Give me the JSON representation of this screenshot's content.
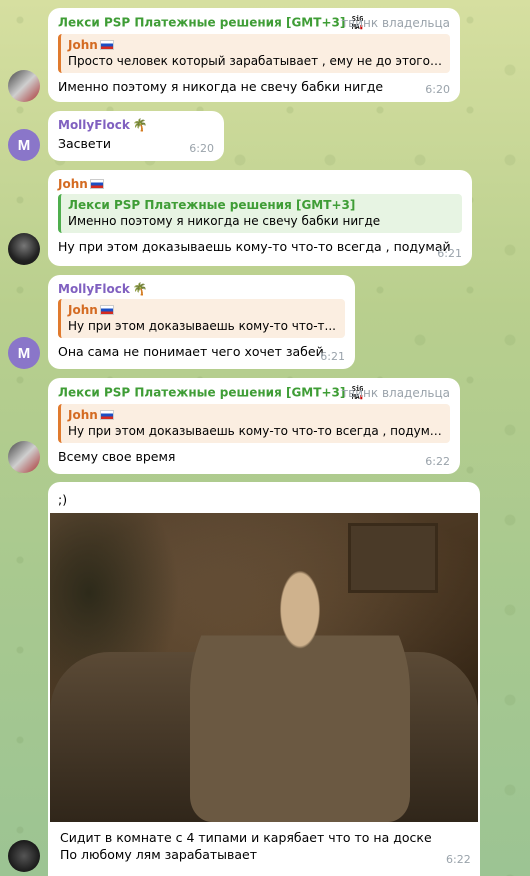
{
  "messages": [
    {
      "sender": "Лекси PSP Платежные решения [GMT+3]",
      "sigma_top": "SiG",
      "sigma_bottom": "MA",
      "tag": "твинк владельца",
      "reply_name": "John",
      "reply_text": "Просто человек который зарабатывает , ему не до этого и...",
      "text": "Именно поэтому я никогда не свечу бабки нигде",
      "time": "6:20"
    },
    {
      "sender": "MollyFlock",
      "avatar_letter": "M",
      "text": "Засвети",
      "time": "6:20"
    },
    {
      "sender": "John",
      "reply_name": "Лекси PSP Платежные решения [GMT+3]",
      "reply_text": "Именно поэтому я никогда не свечу бабки нигде",
      "text": "Ну при этом доказываешь кому-то что-то всегда , подумай",
      "time": "6:21"
    },
    {
      "sender": "MollyFlock",
      "avatar_letter": "M",
      "reply_name": "John",
      "reply_text": "Ну при этом доказываешь кому-то что-т...",
      "text": "Она сама не понимает чего хочет забей",
      "time": "6:21"
    },
    {
      "sender": "Лекси PSP Платежные решения [GMT+3]",
      "sigma_top": "SiG",
      "sigma_bottom": "MA",
      "tag": "твинк владельца",
      "reply_name": "John",
      "reply_text": "Ну при этом доказываешь кому-то что-то всегда , подумай",
      "text": "Всему свое время",
      "time": "6:22"
    },
    {
      "text_top": ";)",
      "caption_line1": "Сидит в комнате с 4 типами и карябает что то на доске",
      "caption_line2": "По любому лям зарабатывает",
      "time": "6:22"
    }
  ]
}
